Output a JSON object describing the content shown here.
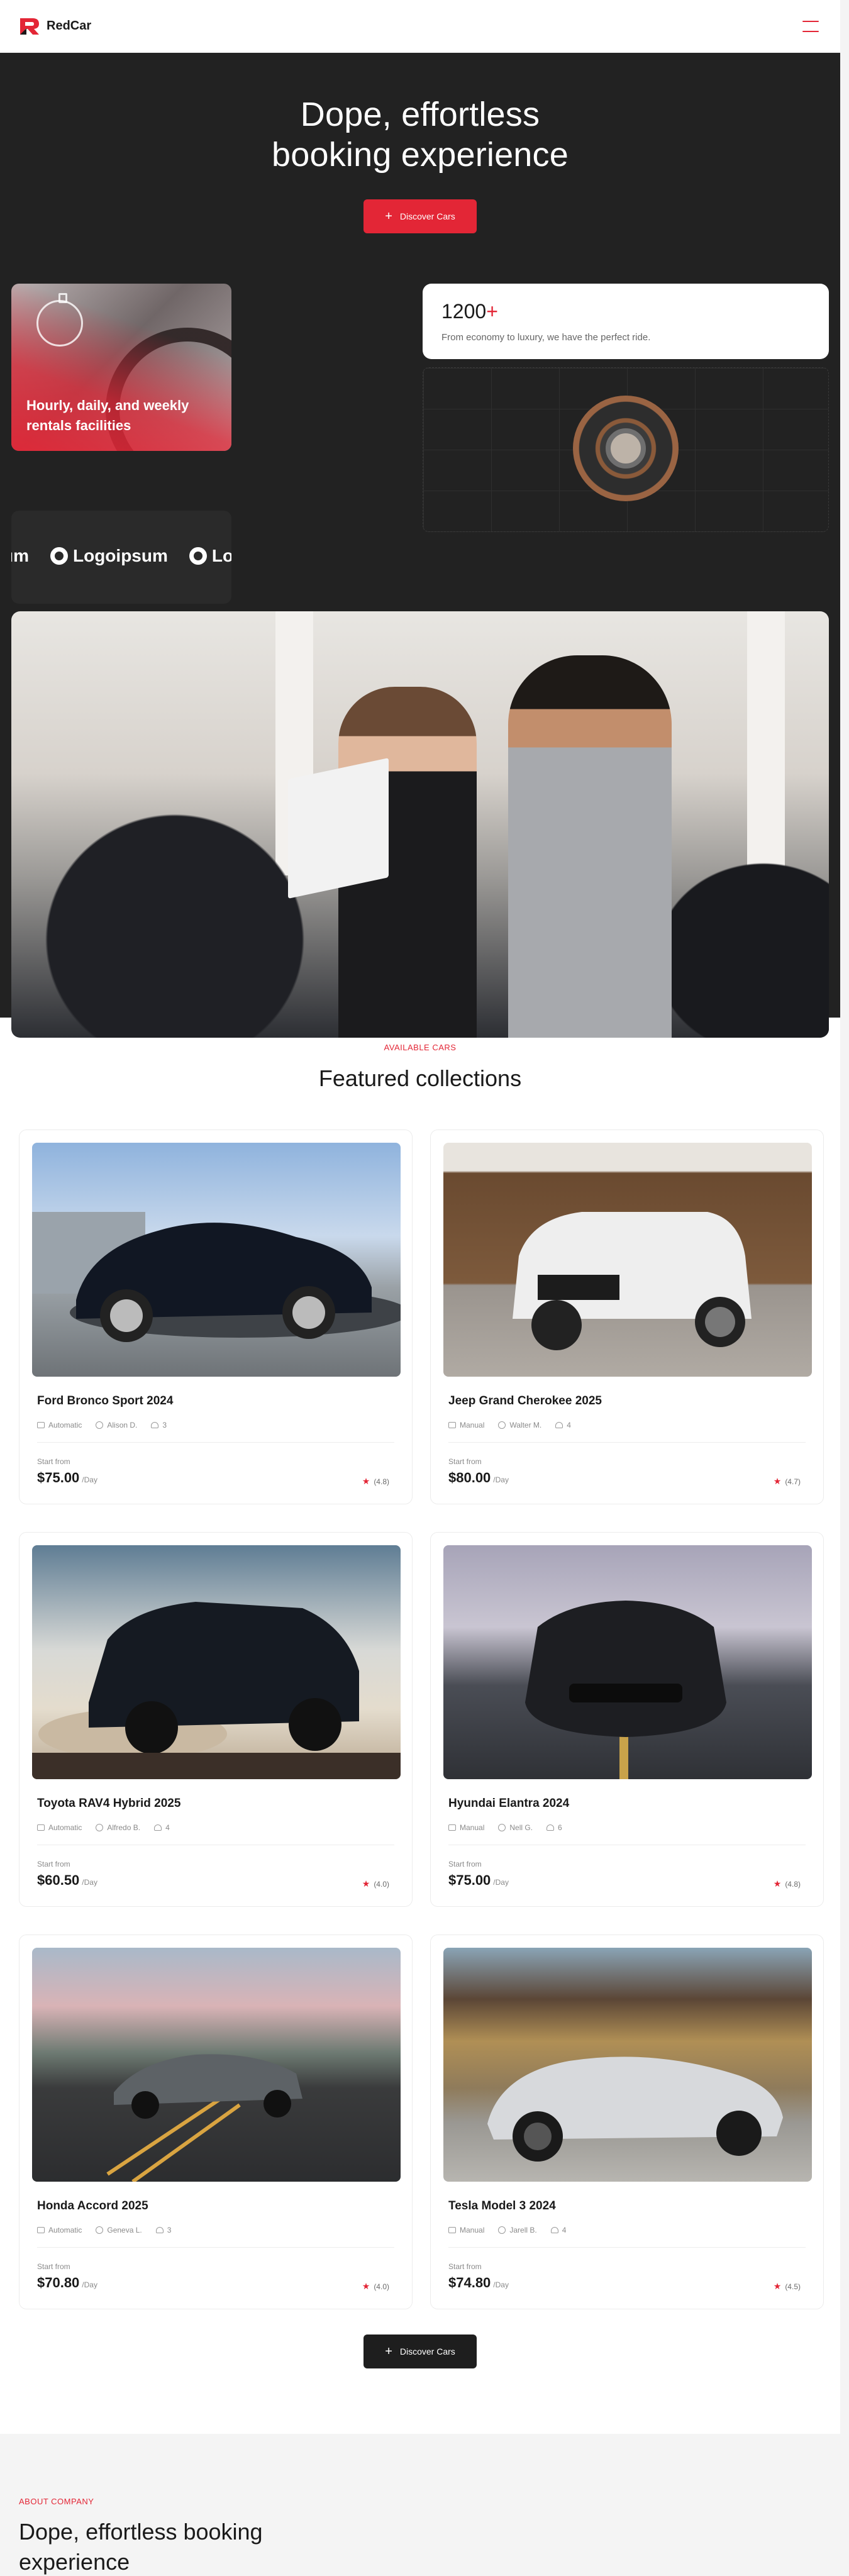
{
  "header": {
    "brand": "RedCar",
    "brand_color": "#e32636",
    "menu_icon": "hamburger-icon"
  },
  "hero": {
    "title_line1": "Dope, effortless",
    "title_line2": "booking experience",
    "cta_label": "Discover Cars",
    "rentals_caption": "Hourly, daily, and weekly rentals facilities",
    "logos": [
      "um",
      "Logoipsum",
      "Lo"
    ],
    "stat": {
      "number": "1200",
      "suffix": "+",
      "description": "From economy to luxury, we have the perfect ride."
    },
    "background": "#222222"
  },
  "featured": {
    "eyebrow": "AVAILABLE CARS",
    "title": "Featured collections",
    "cars": [
      {
        "name": "Ford Bronco Sport 2024",
        "transmission": "Automatic",
        "owner": "Alison D.",
        "seats": "3",
        "price_label": "Start from",
        "price": "$75.00",
        "per": "/Day",
        "rating": "(4.8)"
      },
      {
        "name": "Jeep Grand Cherokee 2025",
        "transmission": "Manual",
        "owner": "Walter M.",
        "seats": "4",
        "price_label": "Start from",
        "price": "$80.00",
        "per": "/Day",
        "rating": "(4.7)"
      },
      {
        "name": "Toyota RAV4 Hybrid 2025",
        "transmission": "Automatic",
        "owner": "Alfredo B.",
        "seats": "4",
        "price_label": "Start from",
        "price": "$60.50",
        "per": "/Day",
        "rating": "(4.0)"
      },
      {
        "name": "Hyundai Elantra 2024",
        "transmission": "Manual",
        "owner": "Nell G.",
        "seats": "6",
        "price_label": "Start from",
        "price": "$75.00",
        "per": "/Day",
        "rating": "(4.8)"
      },
      {
        "name": "Honda Accord 2025",
        "transmission": "Automatic",
        "owner": "Geneva L.",
        "seats": "3",
        "price_label": "Start from",
        "price": "$70.80",
        "per": "/Day",
        "rating": "(4.0)"
      },
      {
        "name": "Tesla Model 3 2024",
        "transmission": "Manual",
        "owner": "Jarell B.",
        "seats": "4",
        "price_label": "Start from",
        "price": "$74.80",
        "per": "/Day",
        "rating": "(4.5)"
      }
    ],
    "cta_label": "Discover Cars"
  },
  "about": {
    "eyebrow": "ABOUT COMPANY",
    "title": "Dope, effortless booking experience"
  }
}
